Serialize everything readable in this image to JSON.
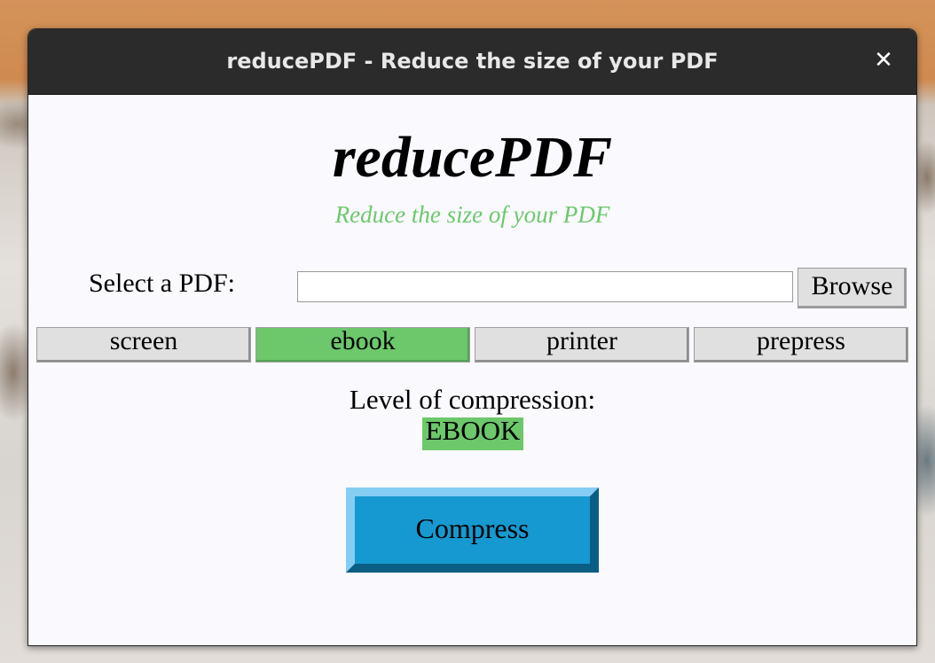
{
  "window": {
    "title": "reducePDF - Reduce the size of your PDF",
    "close_glyph": "✕"
  },
  "header": {
    "app_title": "reducePDF",
    "subtitle": "Reduce the size of your PDF"
  },
  "file_select": {
    "label": "Select a PDF:",
    "value": "",
    "placeholder": "",
    "browse_label": "Browse"
  },
  "presets": [
    {
      "label": "screen",
      "selected": false
    },
    {
      "label": "ebook",
      "selected": true
    },
    {
      "label": "printer",
      "selected": false
    },
    {
      "label": "prepress",
      "selected": false
    }
  ],
  "compression": {
    "label": "Level of compression:",
    "value": "EBOOK"
  },
  "actions": {
    "compress_label": "Compress"
  },
  "colors": {
    "accent_green": "#6cc86a",
    "compress_blue": "#1699d0",
    "titlebar": "#2b2b2b"
  }
}
